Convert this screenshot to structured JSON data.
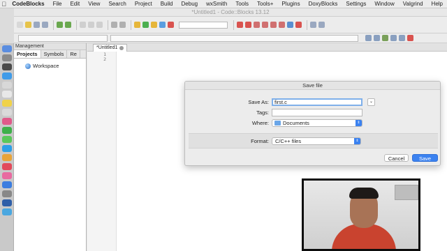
{
  "menubar": {
    "apple": "",
    "app_name": "CodeBlocks",
    "items": [
      "File",
      "Edit",
      "View",
      "Search",
      "Project",
      "Build",
      "Debug",
      "wxSmith",
      "Tools",
      "Tools+",
      "Plugins",
      "DoxyBlocks",
      "Settings",
      "Window",
      "Valgrind",
      "Help"
    ]
  },
  "window": {
    "title": "*Untitled1 - Code::Blocks 13.12"
  },
  "management": {
    "title": "Management",
    "tabs": [
      "Projects",
      "Symbols",
      "Re"
    ],
    "active_tab": "Projects",
    "tree_root": "Workspace"
  },
  "editor": {
    "tab_label": "*Untitled1",
    "line_numbers": [
      "1",
      "2"
    ]
  },
  "dialog": {
    "title": "Save file",
    "save_as_label": "Save As:",
    "save_as_value": "first.c",
    "tags_label": "Tags:",
    "tags_value": "",
    "where_label": "Where:",
    "where_value": "Documents",
    "format_label": "Format:",
    "format_value": "C/C++ files",
    "cancel_label": "Cancel",
    "save_label": "Save",
    "expand_icon": "chevron-down-icon",
    "accent_color": "#3b82f0"
  }
}
